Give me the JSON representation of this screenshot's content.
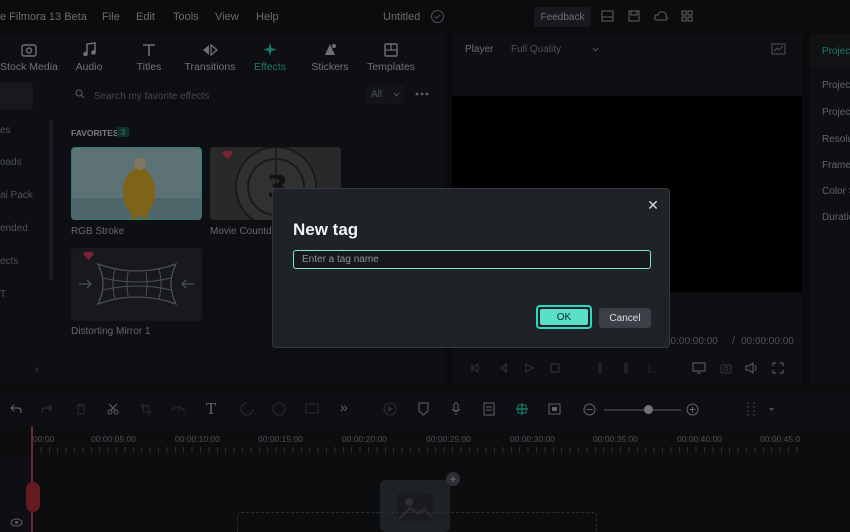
{
  "titlebar": {
    "app_title": "e Filmora 13 Beta",
    "menu": [
      "File",
      "Edit",
      "Tools",
      "View",
      "Help"
    ],
    "project_name": "Untitled",
    "feedback_label": "Feedback"
  },
  "tabs": [
    {
      "label": "Stock Media",
      "icon": "stock-media-icon"
    },
    {
      "label": "Audio",
      "icon": "music-note-icon"
    },
    {
      "label": "Titles",
      "icon": "text-t-icon"
    },
    {
      "label": "Transitions",
      "icon": "transition-arrows-icon"
    },
    {
      "label": "Effects",
      "icon": "sparkle-icon",
      "active": true
    },
    {
      "label": "Stickers",
      "icon": "sticker-icon"
    },
    {
      "label": "Templates",
      "icon": "template-icon"
    }
  ],
  "sidebar": {
    "items": [
      "es",
      "oads",
      "al Pack",
      "ended",
      "ects",
      "T"
    ]
  },
  "effects": {
    "search_placeholder": "Search my favorite effects",
    "filter_value": "All",
    "favorites_label": "FAVORITES",
    "favorites_count": "3",
    "items": [
      {
        "label": "RGB Stroke"
      },
      {
        "label": "Movie Countd"
      },
      {
        "label": "Distorting Mirror 1"
      }
    ]
  },
  "player": {
    "label": "Player",
    "quality": "Full Quality",
    "time_current": "00:00:00:00",
    "time_separator": "/",
    "time_total": "00:00:00:00"
  },
  "project": {
    "tab": "Projec",
    "rows": [
      "Projec",
      "Projec",
      "Resolu",
      "Frame",
      "Color S",
      "Duratio"
    ]
  },
  "timeline": {
    "ticks": [
      "00:00",
      "00:00:05:00",
      "00:00:10:00",
      "00:00:15:00",
      "00:00:20:00",
      "00:00:25:00",
      "00:00:30:00",
      "00:00:35:00",
      "00:00:40:00",
      "00:00:45:0"
    ]
  },
  "dialog": {
    "title": "New tag",
    "input_placeholder": "Enter a tag name",
    "input_value": "",
    "ok_label": "OK",
    "cancel_label": "Cancel",
    "close_glyph": "✕"
  },
  "colors": {
    "accent": "#37d6c0",
    "ok_button": "#5ae0c9",
    "background": "#121417",
    "panel": "#1a1d21"
  }
}
